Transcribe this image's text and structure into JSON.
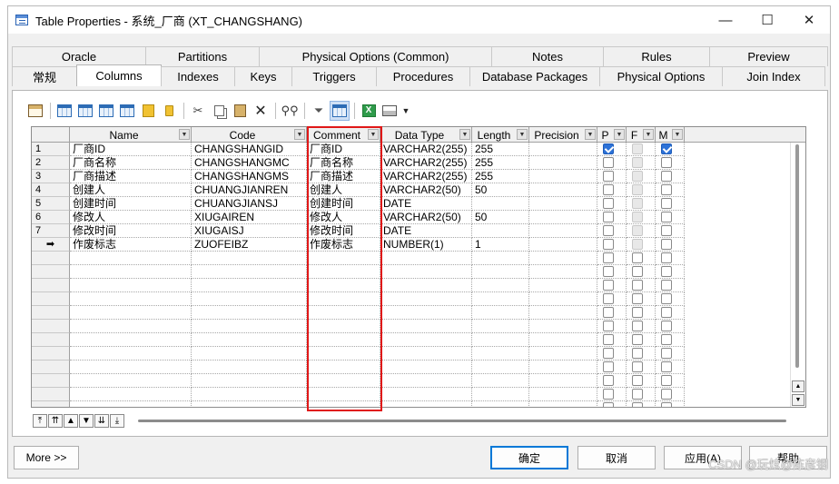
{
  "window": {
    "title": "Table Properties - 系统_厂商 (XT_CHANGSHANG)",
    "controls": {
      "minimize": "—",
      "maximize": "☐",
      "close": "✕"
    }
  },
  "tabs": {
    "back_row": [
      "Oracle",
      "Partitions",
      "Physical Options (Common)",
      "Notes",
      "Rules",
      "Preview"
    ],
    "front_row": [
      "常规",
      "Columns",
      "Indexes",
      "Keys",
      "Triggers",
      "Procedures",
      "Database Packages",
      "Physical Options",
      "Join Index"
    ],
    "active": "Columns"
  },
  "toolbar": {
    "icons": [
      "properties-icon",
      "add-row-icon",
      "insert-row-icon",
      "add-columns-icon",
      "replace-columns-icon",
      "paste-special-icon",
      "new-icon",
      "cut-icon",
      "copy-icon",
      "paste-icon",
      "delete-icon",
      "find-icon",
      "filter-icon",
      "customize-columns-icon",
      "export-excel-icon",
      "print-icon",
      "dropdown-icon"
    ],
    "excel_glyph": "X"
  },
  "grid": {
    "headers": [
      "Name",
      "Code",
      "Comment",
      "Data Type",
      "Length",
      "Precision",
      "P",
      "F",
      "M"
    ],
    "rows": [
      {
        "num": "1",
        "name": "厂商ID",
        "code": "CHANGSHANGID",
        "comment": "厂商ID",
        "datatype": "VARCHAR2(255)",
        "length": "255",
        "precision": "",
        "p": true,
        "m": true
      },
      {
        "num": "2",
        "name": "厂商名称",
        "code": "CHANGSHANGMC",
        "comment": "厂商名称",
        "datatype": "VARCHAR2(255)",
        "length": "255",
        "precision": "",
        "p": false,
        "m": false
      },
      {
        "num": "3",
        "name": "厂商描述",
        "code": "CHANGSHANGMS",
        "comment": "厂商描述",
        "datatype": "VARCHAR2(255)",
        "length": "255",
        "precision": "",
        "p": false,
        "m": false
      },
      {
        "num": "4",
        "name": "创建人",
        "code": "CHUANGJIANREN",
        "comment": "创建人",
        "datatype": "VARCHAR2(50)",
        "length": "50",
        "precision": "",
        "p": false,
        "m": false
      },
      {
        "num": "5",
        "name": "创建时间",
        "code": "CHUANGJIANSJ",
        "comment": "创建时间",
        "datatype": "DATE",
        "length": "",
        "precision": "",
        "p": false,
        "m": false
      },
      {
        "num": "6",
        "name": "修改人",
        "code": "XIUGAIREN",
        "comment": "修改人",
        "datatype": "VARCHAR2(50)",
        "length": "50",
        "precision": "",
        "p": false,
        "m": false
      },
      {
        "num": "7",
        "name": "修改时间",
        "code": "XIUGAISJ",
        "comment": "修改时间",
        "datatype": "DATE",
        "length": "",
        "precision": "",
        "p": false,
        "m": false
      },
      {
        "num": "➡",
        "name": "作废标志",
        "code": "ZUOFEIBZ",
        "comment": "作废标志",
        "datatype": "NUMBER(1)",
        "length": "1",
        "precision": "",
        "p": false,
        "m": false
      }
    ],
    "empty_rows": 12
  },
  "nav_buttons": [
    "⤒",
    "⇈",
    "▲",
    "▼",
    "⇊",
    "⤓"
  ],
  "footer": {
    "more": "More >>",
    "ok": "确定",
    "cancel": "取消",
    "apply": "应用(A)",
    "help": "帮助"
  },
  "watermark": "CSDN @玩炫@陈彦钢"
}
